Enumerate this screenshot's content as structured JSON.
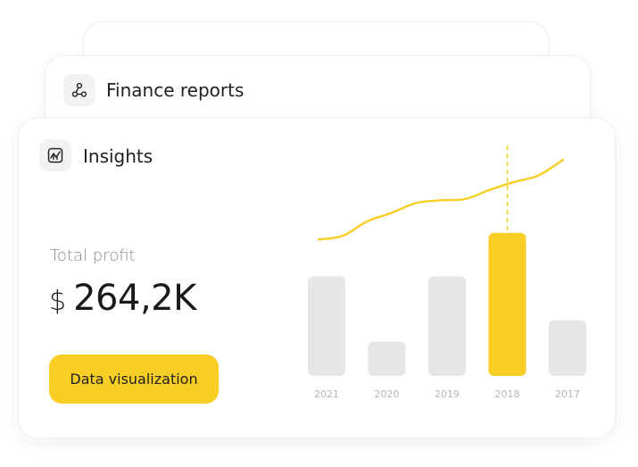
{
  "cards": {
    "finance": {
      "title": "Finance reports",
      "icon": "network-nodes-icon"
    },
    "insights": {
      "title": "Insights",
      "icon": "chart-frame-icon",
      "profit_label": "Total profit",
      "currency": "$",
      "profit_value": "264,2K",
      "button_label": "Data visualization"
    }
  },
  "colors": {
    "accent": "#f8ce24",
    "bar_default": "#e6e6e6",
    "text_muted": "#8a8a8a"
  },
  "chart_data": {
    "type": "bar",
    "categories": [
      "2021",
      "2020",
      "2019",
      "2018",
      "2017"
    ],
    "values": [
      113,
      39,
      113,
      162,
      63
    ],
    "highlight_index": 3,
    "ylim": [
      0,
      170
    ],
    "grid": false,
    "trend_line": {
      "type": "line",
      "values": [
        20,
        26,
        48,
        61,
        76,
        80,
        82,
        96,
        108,
        118,
        142
      ]
    }
  }
}
